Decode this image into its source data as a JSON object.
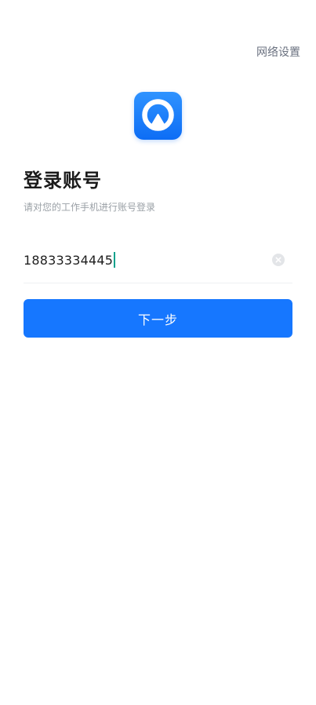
{
  "header": {
    "network_settings_label": "网络设置"
  },
  "login": {
    "title": "登录账号",
    "subtitle": "请对您的工作手机进行账号登录",
    "phone_value": "18833334445",
    "next_label": "下一步"
  },
  "colors": {
    "primary": "#1677ff",
    "logo": "#0d6df5",
    "caret": "#0aa18c"
  },
  "icons": {
    "logo": "app-logo-icon",
    "clear": "clear-input-icon"
  }
}
